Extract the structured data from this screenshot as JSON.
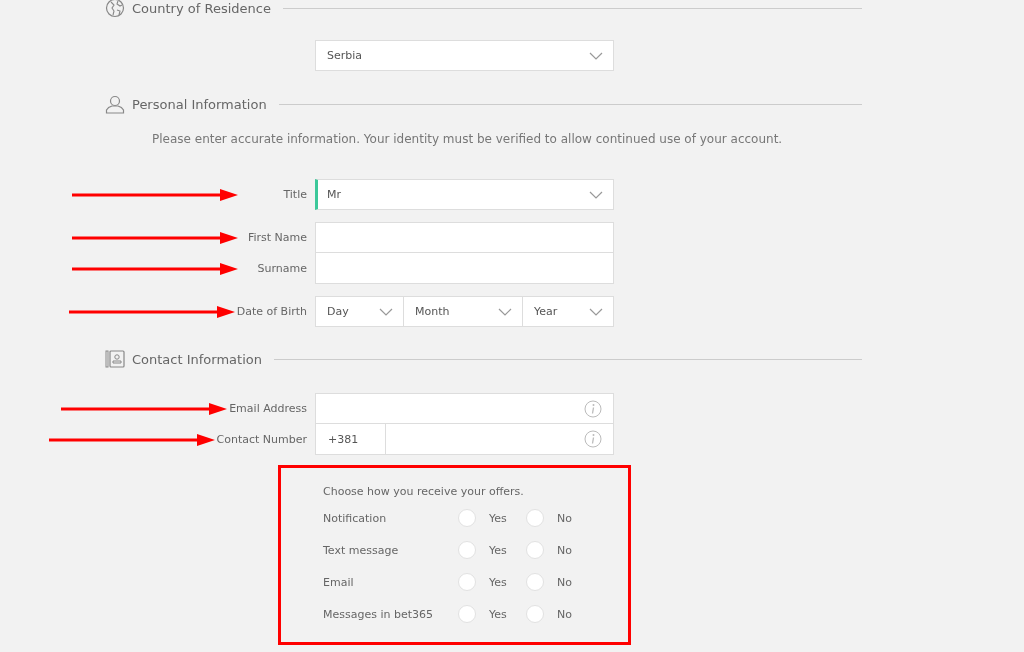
{
  "sections": [
    {
      "kind": "country",
      "title": "Country of Residence",
      "fields": [
        {
          "kind": "select",
          "value": "Serbia",
          "arrow": false,
          "highlighted": false
        }
      ]
    },
    {
      "kind": "person",
      "title": "Personal Information",
      "note": "Please enter accurate information. Your identity must be verified to allow continued use of your account.",
      "fields": [
        {
          "kind": "select",
          "label": "Title",
          "value": "Mr",
          "arrow": true,
          "highlighted": true
        },
        {
          "kind": "text",
          "label": "First Name",
          "arrow": true,
          "joined": false
        },
        {
          "kind": "text",
          "label": "Surname",
          "arrow": true,
          "joined": true
        },
        {
          "kind": "date",
          "label": "Date of Birth",
          "arrow": true,
          "parts": [
            "Day",
            "Month",
            "Year"
          ]
        }
      ]
    },
    {
      "kind": "contact",
      "title": "Contact Information",
      "fields": [
        {
          "kind": "text",
          "label": "Email Address",
          "arrow": true,
          "joined": false,
          "info": true
        },
        {
          "kind": "phone",
          "label": "Contact Number",
          "prefix": "+381",
          "arrow": true,
          "joined": true,
          "info": true
        }
      ],
      "offers": {
        "outlined": true,
        "title": "Choose how you receive your offers.",
        "rows": [
          {
            "label": "Notification",
            "options": [
              {
                "label": "Yes",
                "selected": false
              },
              {
                "label": "No",
                "selected": false
              }
            ]
          },
          {
            "label": "Text message",
            "options": [
              {
                "label": "Yes",
                "selected": false
              },
              {
                "label": "No",
                "selected": false
              }
            ]
          },
          {
            "label": "Email",
            "options": [
              {
                "label": "Yes",
                "selected": false
              },
              {
                "label": "No",
                "selected": false
              }
            ]
          },
          {
            "label": "Messages in bet365",
            "options": [
              {
                "label": "Yes",
                "selected": false
              },
              {
                "label": "No",
                "selected": false
              }
            ]
          }
        ]
      }
    }
  ]
}
